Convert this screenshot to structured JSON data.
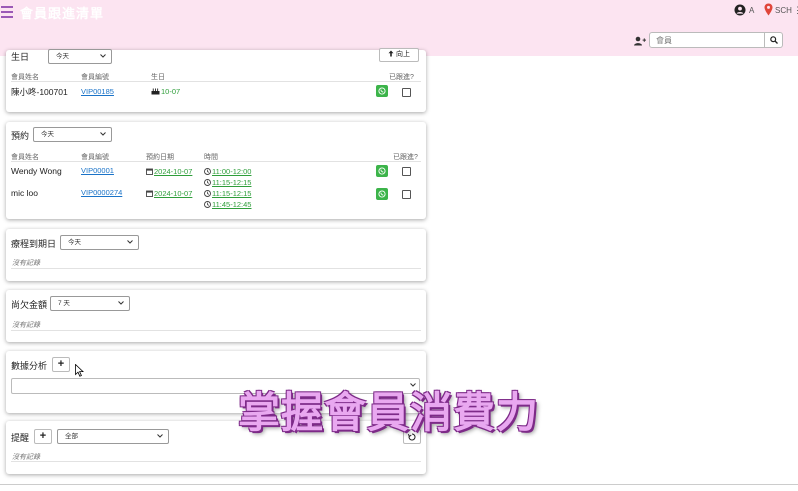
{
  "header": {
    "title": "會員跟進清單",
    "user_label": "A",
    "branch_label": "SCH",
    "more": "⋮",
    "search_placeholder": "會員"
  },
  "birthday": {
    "title": "生日",
    "filter_value": "今天",
    "up_label": "向上",
    "columns": [
      "會員姓名",
      "會員編號",
      "生日",
      "已跟進?"
    ],
    "rows": [
      {
        "name": "陳小咚-100701",
        "member_id": "VIP00185",
        "birthday": "10-07"
      }
    ]
  },
  "booking": {
    "title": "預約",
    "filter_value": "今天",
    "columns": [
      "會員姓名",
      "會員編號",
      "預約日期",
      "時間",
      "已跟進?"
    ],
    "rows": [
      {
        "name": "Wendy Wong",
        "member_id": "VIP00001",
        "date": "2024-10-07",
        "times": [
          "11:00-12:00",
          "11:15-12:15"
        ]
      },
      {
        "name": "mic loo",
        "member_id": "VIP0000274",
        "date": "2024-10-07",
        "times": [
          "11:15-12:15",
          "11:45-12:45"
        ]
      }
    ]
  },
  "treatment_expiry": {
    "title": "療程到期日",
    "filter_value": "今天",
    "empty": "沒有記錄"
  },
  "outstanding": {
    "title": "尚欠金額",
    "filter_value": "7 天",
    "empty": "沒有記錄"
  },
  "analysis": {
    "title": "數據分析",
    "add_label": "+"
  },
  "reminder": {
    "title": "提醒",
    "add_label": "+",
    "filter_value": "全部",
    "empty": "沒有記錄"
  },
  "watermark": "掌握會員消費力",
  "colors": {
    "header_bg": "#fce4f1",
    "accent_purple": "#9b59b6",
    "whatsapp_green": "#3cb44a",
    "link_blue": "#1a73c8",
    "date_green": "#2e9e3a"
  }
}
